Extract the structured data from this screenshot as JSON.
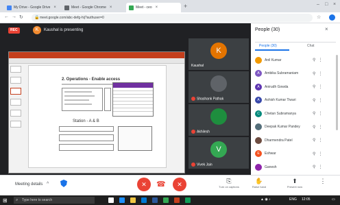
{
  "browser": {
    "tabs": [
      {
        "label": "My Drive - Google Drive",
        "color": "#4285f4"
      },
      {
        "label": "Meet - Google Chrome",
        "color": "#5f6368"
      },
      {
        "label": "Meet - ceo",
        "color": "#34a853",
        "active": true
      }
    ],
    "url": "meet.google.com/abc-defg-hij?authuser=0"
  },
  "meet": {
    "rec_label": "REC",
    "presenter_initial": "K",
    "presenting_text": "Kaushal is presenting"
  },
  "slide": {
    "title": "2. Operations - Enable access",
    "subtitle": "Station - A & B"
  },
  "tiles": [
    {
      "initial": "K",
      "name": "Kaushal",
      "avatar_color": "#e37400",
      "muted": false
    },
    {
      "initial": "",
      "name": "Shashank Pathak",
      "avatar_color": "#5f6368",
      "muted": true
    },
    {
      "initial": "",
      "name": "Akhilesh",
      "avatar_color": "#1e8e3e",
      "muted": true
    },
    {
      "initial": "V",
      "name": "Vivek Jain",
      "avatar_color": "#34a853",
      "muted": true
    }
  ],
  "people_panel": {
    "title": "People (30)",
    "close_icon": "close-icon",
    "tab_people": "People (30)",
    "tab_chat": "Chat",
    "participants": [
      {
        "initial": "",
        "name": "Anil Kumar",
        "color": "#f29900"
      },
      {
        "initial": "A",
        "name": "Ambika Subramaniam",
        "color": "#7e57c2"
      },
      {
        "initial": "A",
        "name": "Anirudh Gowda",
        "color": "#5e35b1"
      },
      {
        "initial": "A",
        "name": "Ashish Kumar Tiwari",
        "color": "#3949ab"
      },
      {
        "initial": "C",
        "name": "Chetan Subramanya",
        "color": "#00897b"
      },
      {
        "initial": "",
        "name": "Deepak Kumar Pandey",
        "color": "#546e7a"
      },
      {
        "initial": "",
        "name": "Dharmendra Patel",
        "color": "#6d4c41"
      },
      {
        "initial": "E",
        "name": "Eshwar",
        "color": "#f4511e"
      },
      {
        "initial": "",
        "name": "Ganesh",
        "color": "#8e24aa"
      }
    ]
  },
  "controls": {
    "meeting_details": "Meeting details",
    "turn_on_captions": "Turn on captions",
    "raise_hand": "Raise hand",
    "present_now": "Present now",
    "more": "More options"
  },
  "taskbar": {
    "search_placeholder": "Type here to search",
    "time": "12:05",
    "lang": "ENG"
  }
}
